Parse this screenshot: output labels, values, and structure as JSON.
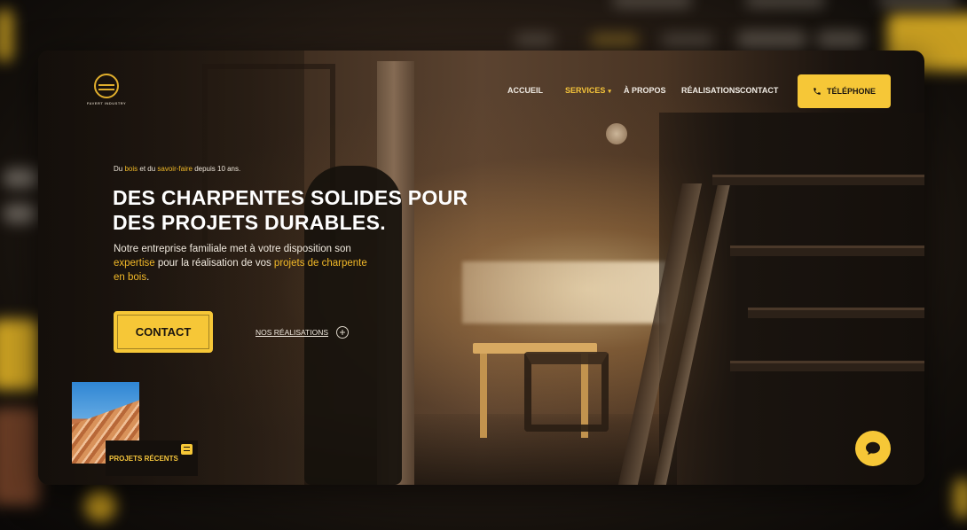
{
  "brand": {
    "logo_text": "FAVERT INDUSTRY",
    "accent_color": "#f6c737",
    "highlight_color": "#f0b928"
  },
  "nav": {
    "items": [
      {
        "label": "ACCUEIL",
        "active": false
      },
      {
        "label": "SERVICES",
        "active": true,
        "has_dropdown": true
      },
      {
        "label": "À PROPOS",
        "active": false
      },
      {
        "label": "RÉALISATIONS",
        "active": false
      },
      {
        "label": "CONTACT",
        "active": false
      }
    ],
    "dropdown_icon": "chevron-down-icon",
    "phone_button": {
      "label": "TÉLÉPHONE",
      "icon": "phone-icon"
    }
  },
  "hero": {
    "kicker": {
      "pre": "Du ",
      "hl1": "bois",
      "mid": " et du ",
      "hl2": "savoir-faire",
      "post": " depuis 10 ans."
    },
    "headline": "DES CHARPENTES SOLIDES POUR DES PROJETS DURABLES.",
    "intro": {
      "p1": "Notre entreprise familiale met à votre disposition son ",
      "hl1": "expertise",
      "p2": " pour la réalisation de vos ",
      "hl2": "projets de charpente en bois",
      "p3": "."
    },
    "contact_button": "CONTACT",
    "realisations_link": "NOS RÉALISATIONS",
    "realisations_icon": "plus-circle-icon"
  },
  "recent_projects": {
    "label": "PROJETS RÉCENTS",
    "icon": "menu-tag-icon"
  },
  "chat": {
    "icon": "chat-bubble-icon"
  }
}
